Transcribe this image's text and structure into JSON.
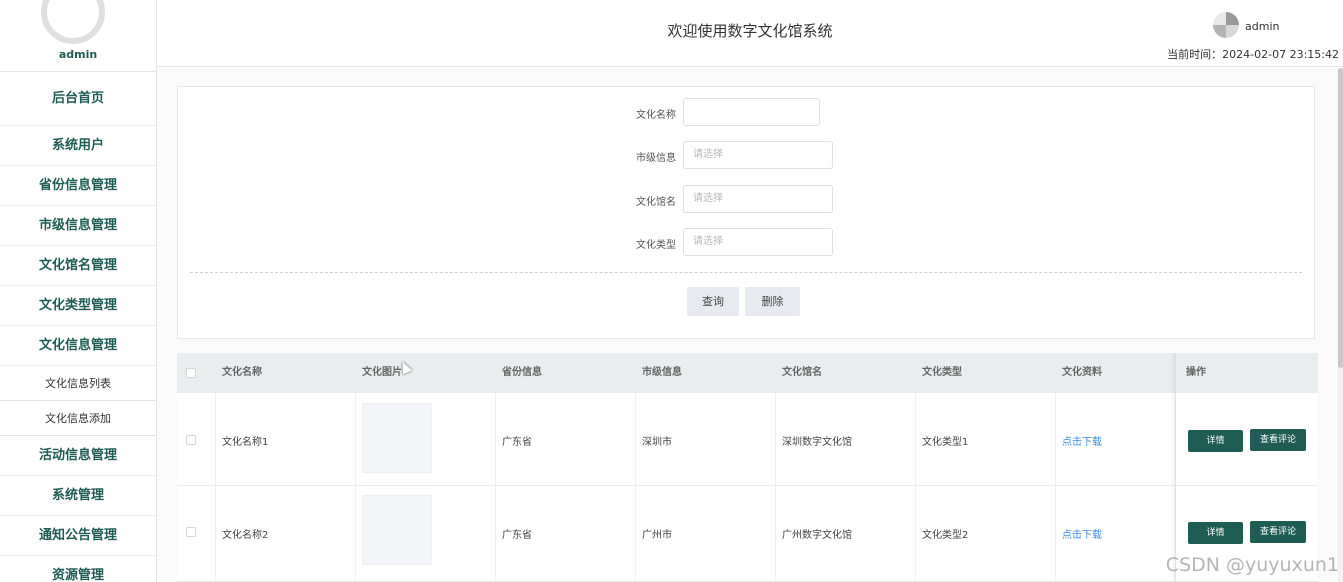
{
  "sidebar": {
    "profile_name": "admin",
    "menu": [
      {
        "label": "后台首页"
      },
      {
        "label": "系统用户"
      },
      {
        "label": "省份信息管理"
      },
      {
        "label": "市级信息管理"
      },
      {
        "label": "文化馆名管理"
      },
      {
        "label": "文化类型管理"
      },
      {
        "label": "文化信息管理"
      },
      {
        "label": "文化信息列表"
      },
      {
        "label": "文化信息添加"
      },
      {
        "label": "活动信息管理"
      },
      {
        "label": "系统管理"
      },
      {
        "label": "通知公告管理"
      },
      {
        "label": "资源管理"
      }
    ]
  },
  "header": {
    "title": "欢迎使用数字文化馆系统",
    "user": "admin",
    "time": "当前时间：2024-02-07 23:15:42"
  },
  "search": {
    "fields": [
      {
        "label": "文化名称",
        "value": ""
      },
      {
        "label": "市级信息",
        "placeholder": "请选择"
      },
      {
        "label": "文化馆名",
        "placeholder": "请选择"
      },
      {
        "label": "文化类型",
        "placeholder": "请选择"
      }
    ],
    "query_label": "查询",
    "delete_label": "删除"
  },
  "table": {
    "columns": [
      "文化名称",
      "文化图片",
      "省份信息",
      "市级信息",
      "文化馆名",
      "文化类型",
      "文化资料",
      "操作"
    ],
    "rows": [
      {
        "name": "文化名称1",
        "province": "广东省",
        "city": "深圳市",
        "hall": "深圳数字文化馆",
        "type": "文化类型1",
        "file": "点击下载"
      },
      {
        "name": "文化名称2",
        "province": "广东省",
        "city": "广州市",
        "hall": "广州数字文化馆",
        "type": "文化类型2",
        "file": "点击下载"
      }
    ],
    "detail_label": "详情",
    "comment_label": "查看评论"
  },
  "watermark": "CSDN @yuyuxun1"
}
